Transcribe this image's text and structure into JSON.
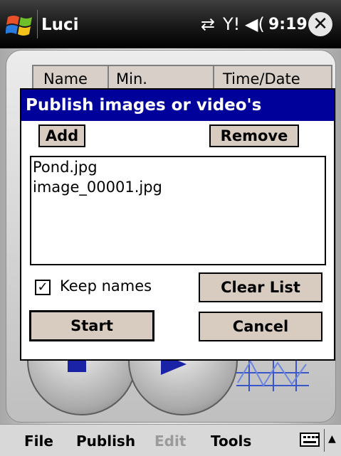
{
  "titlebar": {
    "app_title": "Luci",
    "clock": "9:19",
    "icons": [
      "windows-start-icon",
      "connectivity-icon",
      "signal-icon",
      "volume-icon",
      "close-icon"
    ]
  },
  "background_app": {
    "columns": [
      "Name",
      "Min.",
      "Time/Date"
    ]
  },
  "dialog": {
    "title": "Publish images or video's",
    "add_label": "Add",
    "remove_label": "Remove",
    "files": [
      "Pond.jpg",
      "image_00001.jpg"
    ],
    "keep_names_label": "Keep names",
    "keep_names_checked": true,
    "clear_list_label": "Clear List",
    "start_label": "Start",
    "cancel_label": "Cancel"
  },
  "menubar": {
    "file": "File",
    "publish": "Publish",
    "edit": "Edit",
    "tools": "Tools"
  },
  "colors": {
    "dialog_title_bg": "#00009a",
    "button_bg": "#d8cbc0"
  }
}
